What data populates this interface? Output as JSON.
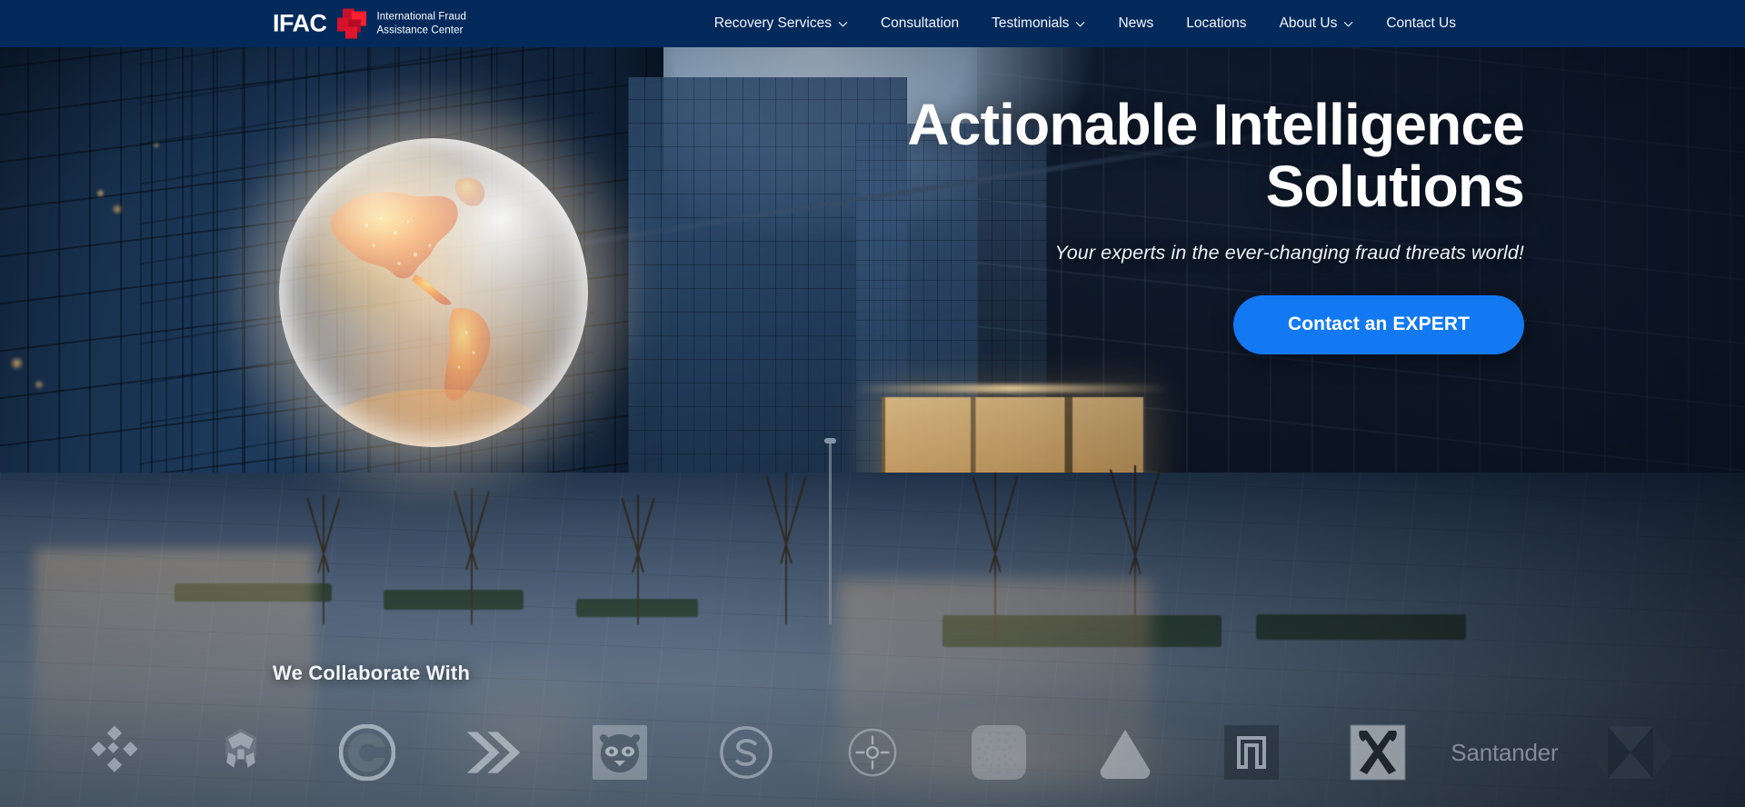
{
  "brand": {
    "acronym": "IFAC",
    "name_line1": "International Fraud",
    "name_line2": "Assistance Center",
    "mark_color": "#e8112d"
  },
  "nav": {
    "items": [
      {
        "label": "Recovery Services",
        "has_dropdown": true,
        "icon": "chevron-down-icon"
      },
      {
        "label": "Consultation",
        "has_dropdown": false,
        "icon": ""
      },
      {
        "label": "Testimonials",
        "has_dropdown": true,
        "icon": "chevron-down-icon"
      },
      {
        "label": "News",
        "has_dropdown": false,
        "icon": ""
      },
      {
        "label": "Locations",
        "has_dropdown": false,
        "icon": ""
      },
      {
        "label": "About Us",
        "has_dropdown": true,
        "icon": "chevron-down-icon"
      },
      {
        "label": "Contact Us",
        "has_dropdown": false,
        "icon": ""
      }
    ],
    "bar_color": "#042a5c"
  },
  "hero": {
    "title_line1": "Actionable Intelligence",
    "title_line2": "Solutions",
    "subtitle": "Your experts in the ever-changing fraud threats world!",
    "cta_label": "Contact an EXPERT",
    "cta_color": "#1279f2",
    "globe_icon": "glowing-earth-globe-americas"
  },
  "collaborate": {
    "title": "We Collaborate With",
    "partners": [
      {
        "name": "Binance",
        "icon": "binance-diamond-logo"
      },
      {
        "name": "Crypto.com",
        "icon": "crypto-com-logo"
      },
      {
        "name": "Coinbase",
        "icon": "coinbase-circle-logo"
      },
      {
        "name": "Bitstamp",
        "icon": "double-chevron-logo"
      },
      {
        "name": "Ronin",
        "icon": "raccoon-face-logo"
      },
      {
        "name": "Solana",
        "icon": "circle-s-logo"
      },
      {
        "name": "Kraken",
        "icon": "compass-circle-logo"
      },
      {
        "name": "IOTA",
        "icon": "dotted-circle-logo"
      },
      {
        "name": "Tron",
        "icon": "triangle-logo"
      },
      {
        "name": "Bank Leumi",
        "icon": "shekel-bracket-logo"
      },
      {
        "name": "Raiffeisen",
        "icon": "crossed-horses-logo"
      },
      {
        "name": "Santander",
        "icon": "santander-flame-wordmark"
      },
      {
        "name": "HSBC",
        "icon": "hsbc-hexagon-logo"
      }
    ]
  }
}
